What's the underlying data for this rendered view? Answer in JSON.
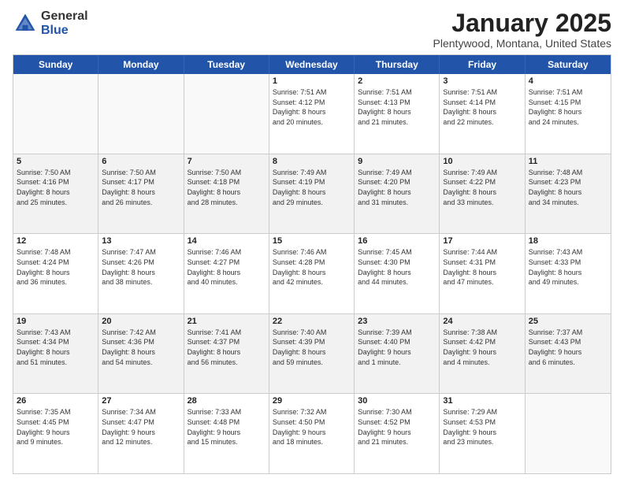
{
  "logo": {
    "general": "General",
    "blue": "Blue"
  },
  "title": {
    "month": "January 2025",
    "location": "Plentywood, Montana, United States"
  },
  "header_days": [
    "Sunday",
    "Monday",
    "Tuesday",
    "Wednesday",
    "Thursday",
    "Friday",
    "Saturday"
  ],
  "weeks": [
    [
      {
        "day": "",
        "info": "",
        "empty": true
      },
      {
        "day": "",
        "info": "",
        "empty": true
      },
      {
        "day": "",
        "info": "",
        "empty": true
      },
      {
        "day": "1",
        "info": "Sunrise: 7:51 AM\nSunset: 4:12 PM\nDaylight: 8 hours\nand 20 minutes."
      },
      {
        "day": "2",
        "info": "Sunrise: 7:51 AM\nSunset: 4:13 PM\nDaylight: 8 hours\nand 21 minutes."
      },
      {
        "day": "3",
        "info": "Sunrise: 7:51 AM\nSunset: 4:14 PM\nDaylight: 8 hours\nand 22 minutes."
      },
      {
        "day": "4",
        "info": "Sunrise: 7:51 AM\nSunset: 4:15 PM\nDaylight: 8 hours\nand 24 minutes."
      }
    ],
    [
      {
        "day": "5",
        "info": "Sunrise: 7:50 AM\nSunset: 4:16 PM\nDaylight: 8 hours\nand 25 minutes."
      },
      {
        "day": "6",
        "info": "Sunrise: 7:50 AM\nSunset: 4:17 PM\nDaylight: 8 hours\nand 26 minutes."
      },
      {
        "day": "7",
        "info": "Sunrise: 7:50 AM\nSunset: 4:18 PM\nDaylight: 8 hours\nand 28 minutes."
      },
      {
        "day": "8",
        "info": "Sunrise: 7:49 AM\nSunset: 4:19 PM\nDaylight: 8 hours\nand 29 minutes."
      },
      {
        "day": "9",
        "info": "Sunrise: 7:49 AM\nSunset: 4:20 PM\nDaylight: 8 hours\nand 31 minutes."
      },
      {
        "day": "10",
        "info": "Sunrise: 7:49 AM\nSunset: 4:22 PM\nDaylight: 8 hours\nand 33 minutes."
      },
      {
        "day": "11",
        "info": "Sunrise: 7:48 AM\nSunset: 4:23 PM\nDaylight: 8 hours\nand 34 minutes."
      }
    ],
    [
      {
        "day": "12",
        "info": "Sunrise: 7:48 AM\nSunset: 4:24 PM\nDaylight: 8 hours\nand 36 minutes."
      },
      {
        "day": "13",
        "info": "Sunrise: 7:47 AM\nSunset: 4:26 PM\nDaylight: 8 hours\nand 38 minutes."
      },
      {
        "day": "14",
        "info": "Sunrise: 7:46 AM\nSunset: 4:27 PM\nDaylight: 8 hours\nand 40 minutes."
      },
      {
        "day": "15",
        "info": "Sunrise: 7:46 AM\nSunset: 4:28 PM\nDaylight: 8 hours\nand 42 minutes."
      },
      {
        "day": "16",
        "info": "Sunrise: 7:45 AM\nSunset: 4:30 PM\nDaylight: 8 hours\nand 44 minutes."
      },
      {
        "day": "17",
        "info": "Sunrise: 7:44 AM\nSunset: 4:31 PM\nDaylight: 8 hours\nand 47 minutes."
      },
      {
        "day": "18",
        "info": "Sunrise: 7:43 AM\nSunset: 4:33 PM\nDaylight: 8 hours\nand 49 minutes."
      }
    ],
    [
      {
        "day": "19",
        "info": "Sunrise: 7:43 AM\nSunset: 4:34 PM\nDaylight: 8 hours\nand 51 minutes."
      },
      {
        "day": "20",
        "info": "Sunrise: 7:42 AM\nSunset: 4:36 PM\nDaylight: 8 hours\nand 54 minutes."
      },
      {
        "day": "21",
        "info": "Sunrise: 7:41 AM\nSunset: 4:37 PM\nDaylight: 8 hours\nand 56 minutes."
      },
      {
        "day": "22",
        "info": "Sunrise: 7:40 AM\nSunset: 4:39 PM\nDaylight: 8 hours\nand 59 minutes."
      },
      {
        "day": "23",
        "info": "Sunrise: 7:39 AM\nSunset: 4:40 PM\nDaylight: 9 hours\nand 1 minute."
      },
      {
        "day": "24",
        "info": "Sunrise: 7:38 AM\nSunset: 4:42 PM\nDaylight: 9 hours\nand 4 minutes."
      },
      {
        "day": "25",
        "info": "Sunrise: 7:37 AM\nSunset: 4:43 PM\nDaylight: 9 hours\nand 6 minutes."
      }
    ],
    [
      {
        "day": "26",
        "info": "Sunrise: 7:35 AM\nSunset: 4:45 PM\nDaylight: 9 hours\nand 9 minutes."
      },
      {
        "day": "27",
        "info": "Sunrise: 7:34 AM\nSunset: 4:47 PM\nDaylight: 9 hours\nand 12 minutes."
      },
      {
        "day": "28",
        "info": "Sunrise: 7:33 AM\nSunset: 4:48 PM\nDaylight: 9 hours\nand 15 minutes."
      },
      {
        "day": "29",
        "info": "Sunrise: 7:32 AM\nSunset: 4:50 PM\nDaylight: 9 hours\nand 18 minutes."
      },
      {
        "day": "30",
        "info": "Sunrise: 7:30 AM\nSunset: 4:52 PM\nDaylight: 9 hours\nand 21 minutes."
      },
      {
        "day": "31",
        "info": "Sunrise: 7:29 AM\nSunset: 4:53 PM\nDaylight: 9 hours\nand 23 minutes."
      },
      {
        "day": "",
        "info": "",
        "empty": true
      }
    ]
  ]
}
